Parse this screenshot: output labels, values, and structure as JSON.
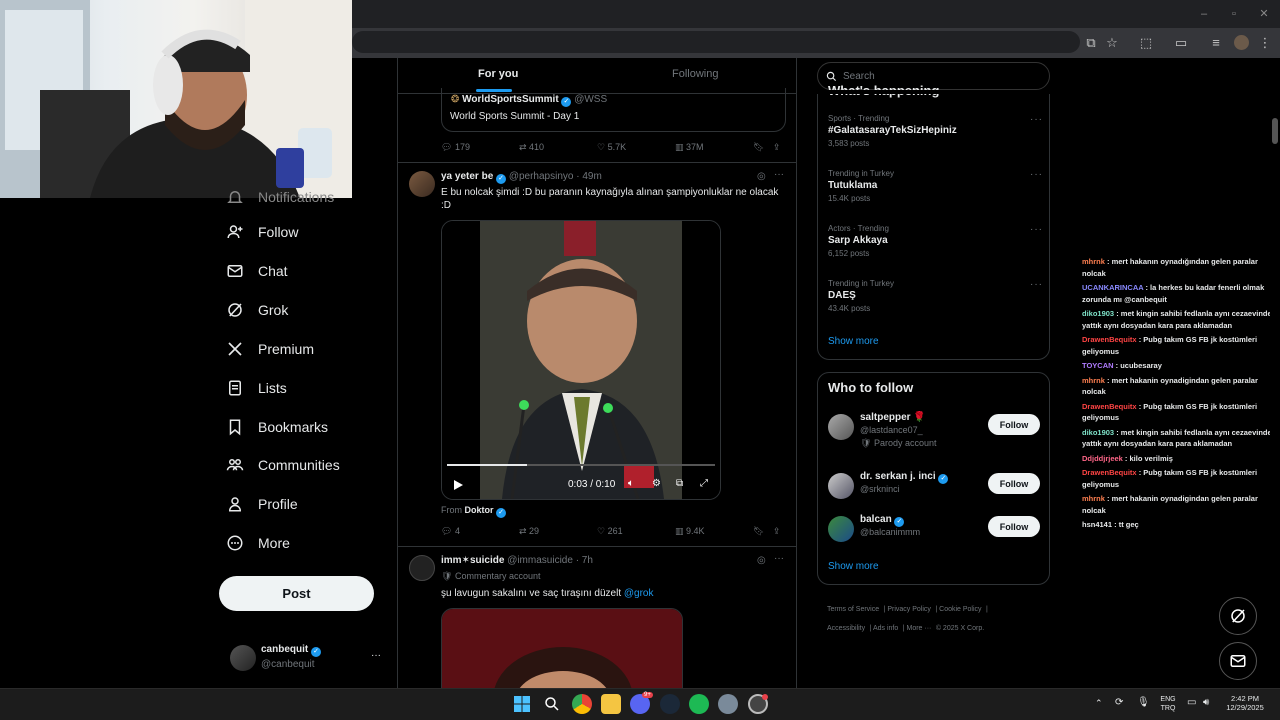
{
  "browser": {
    "title_bar": "",
    "address": ""
  },
  "nav": {
    "partial_item": "Notifications",
    "items": [
      {
        "label": "Follow",
        "icon": "person-add-icon"
      },
      {
        "label": "Chat",
        "icon": "mail-icon"
      },
      {
        "label": "Grok",
        "icon": "grok-icon"
      },
      {
        "label": "Premium",
        "icon": "x-logo-icon"
      },
      {
        "label": "Lists",
        "icon": "list-icon"
      },
      {
        "label": "Bookmarks",
        "icon": "bookmark-icon"
      },
      {
        "label": "Communities",
        "icon": "communities-icon"
      },
      {
        "label": "Profile",
        "icon": "person-icon"
      },
      {
        "label": "More",
        "icon": "more-circle-icon"
      }
    ],
    "post_button": "Post",
    "account": {
      "name": "canbequit",
      "handle": "@canbequit"
    }
  },
  "tabs": {
    "for_you": "For you",
    "following": "Following"
  },
  "feed": {
    "quoted": {
      "name": "WorldSportsSummit",
      "handle": "@WSS",
      "text": "World Sports Summit - Day 1"
    },
    "post1_actions": {
      "replies": "179",
      "reposts": "410",
      "likes": "5.7K",
      "views": "37M"
    },
    "post2": {
      "name": "ya yeter be",
      "handle": "@perhapsinyo",
      "time": "· 49m",
      "text": "E bu nolcak şimdi :D bu paranın kaynağıyla alınan şampiyonluklar ne olacak :D",
      "video_time": "0:03 / 0:10",
      "video_progress": 0.3,
      "from_label": "From",
      "from_source": "Doktor",
      "actions": {
        "replies": "4",
        "reposts": "29",
        "likes": "261",
        "views": "9.4K"
      }
    },
    "post3": {
      "name": "imm✶suicide",
      "handle": "@immasuicide",
      "time": "· 7h",
      "badge": "Commentary account",
      "text": "şu lavugun sakalını ve saç tıraşını düzelt",
      "mention": "@grok"
    }
  },
  "search": {
    "placeholder": "Search"
  },
  "whats_happening": {
    "heading": "What's happening",
    "trends": [
      {
        "meta": "Sports · Trending",
        "title": "#GalatasarayTekSizHepiniz",
        "count": "3,583 posts"
      },
      {
        "meta": "Trending in Turkey",
        "title": "Tutuklama",
        "count": "15.4K posts"
      },
      {
        "meta": "Actors · Trending",
        "title": "Sarp Akkaya",
        "count": "6,152 posts"
      },
      {
        "meta": "Trending in Turkey",
        "title": "DAEŞ",
        "count": "43.4K posts"
      }
    ],
    "show_more": "Show more"
  },
  "who_to_follow": {
    "heading": "Who to follow",
    "users": [
      {
        "name": "saltpepper 🌹",
        "handle": "@lastdance07_",
        "extra": "Parody account",
        "button": "Follow"
      },
      {
        "name": "dr. serkan j. inci",
        "handle": "@srkninci",
        "extra": "",
        "button": "Follow"
      },
      {
        "name": "balcan",
        "handle": "@balcanimmm",
        "extra": "",
        "button": "Follow"
      }
    ],
    "show_more": "Show more"
  },
  "footer": {
    "links": [
      "Terms of Service",
      "Privacy Policy",
      "Cookie Policy",
      "Accessibility",
      "Ads info",
      "More ···"
    ],
    "copyright": "© 2025 X Corp."
  },
  "chat": [
    {
      "user": "mhrnk",
      "color": "#ff7f50",
      "text": " : mert hakanın oynadığından gelen paralar nolcak"
    },
    {
      "user": "UCANKARINCAA",
      "color": "#8a8aff",
      "text": " : la herkes bu kadar fenerli olmak zorunda mı @canbequit"
    },
    {
      "user": "diko1903",
      "color": "#7fe3c9",
      "text": " : met kingin sahibi fedlanla aynı cezaevinde yattık aynı dosyadan kara para aklamadan"
    },
    {
      "user": "DrawenBequitx",
      "color": "#ff4444",
      "text": " : Pubg takım GS FB jk kostümleri geliyomus"
    },
    {
      "user": "TOYCAN",
      "color": "#b07cff",
      "text": " : ucubesaray"
    },
    {
      "user": "mhrnk",
      "color": "#ff7f50",
      "text": " : mert hakanin oynadigindan gelen paralar nolcak"
    },
    {
      "user": "DrawenBequitx",
      "color": "#ff4444",
      "text": " : Pubg takım GS FB jk kostümleri geliyomus"
    },
    {
      "user": "diko1903",
      "color": "#7fe3c9",
      "text": " : met kingin sahibi fedlanla aynı cezaevinde yattık aynı dosyadan kara para aklamadan"
    },
    {
      "user": "Ddjddjrjeek",
      "color": "#ff6688",
      "text": " : kilo verilmiş"
    },
    {
      "user": "DrawenBequitx",
      "color": "#ff4444",
      "text": " : Pubg takım GS FB jk kostümleri geliyomus"
    },
    {
      "user": "mhrnk",
      "color": "#ff7f50",
      "text": " : mert hakanin oynadigindan gelen paralar nolcak"
    },
    {
      "user": "hsn4141",
      "color": "#e7e9ea",
      "text": " : tt geç"
    }
  ],
  "taskbar": {
    "lang": "ENG",
    "layout": "TRQ",
    "time": "2:42 PM",
    "date": "12/29/2025",
    "discord_badge": "9+"
  },
  "colors": {
    "accent": "#1d9bf0",
    "bg": "#000000",
    "border": "#2f3336",
    "muted": "#71767b"
  }
}
